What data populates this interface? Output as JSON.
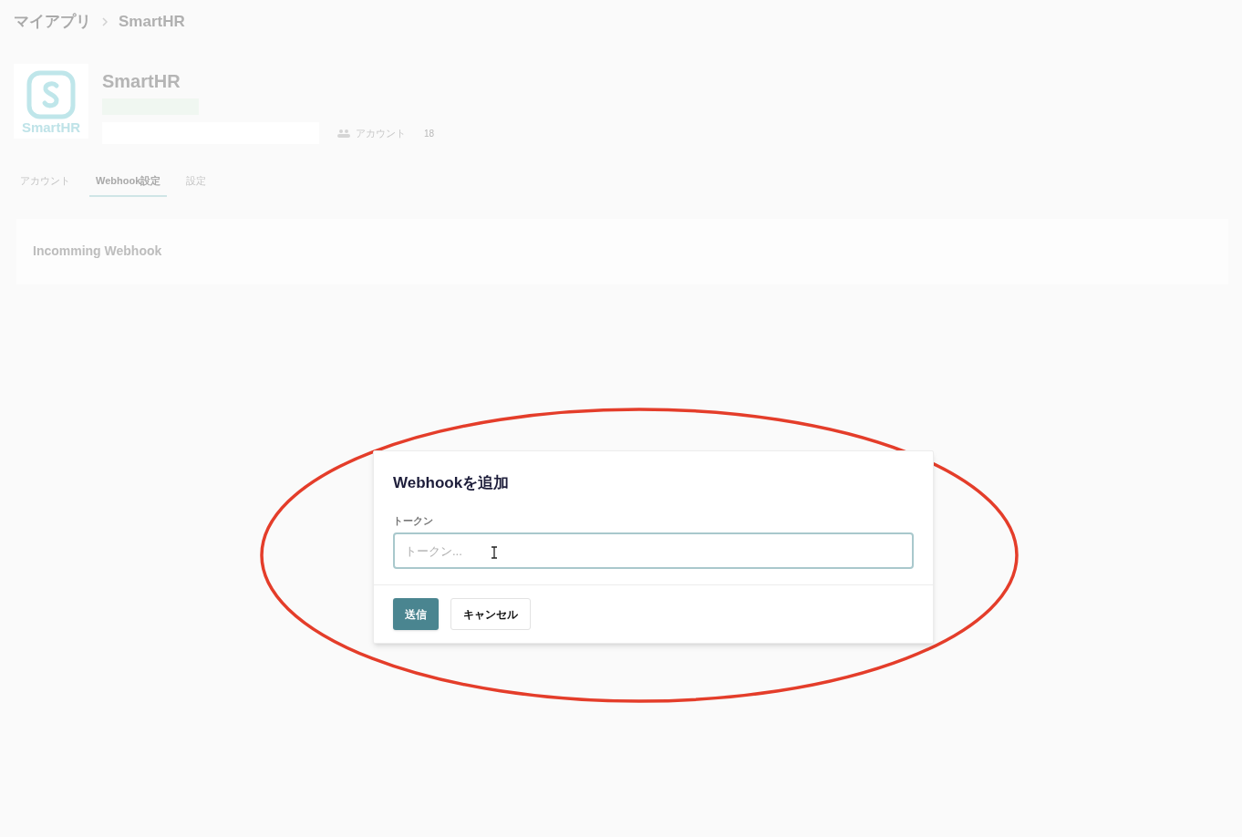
{
  "breadcrumb": [
    "マイアプリ",
    "SmartHR"
  ],
  "app": {
    "logo_text": "SmartHR",
    "name": "SmartHR",
    "accounts_label": "アカウント",
    "accounts_count": "18"
  },
  "tabs": [
    {
      "label": "アカウント",
      "selected": false
    },
    {
      "label": "Webhook設定",
      "selected": true
    },
    {
      "label": "設定",
      "selected": false
    }
  ],
  "section": {
    "title": "Incomming Webhook"
  },
  "dialog": {
    "title": "Webhookを追加",
    "field_label": "トークン",
    "placeholder": "トークン...",
    "buttons": [
      {
        "label": "送信",
        "kind": "primary"
      },
      {
        "label": "キャンセル",
        "kind": "secondary"
      }
    ]
  },
  "annotation": {
    "kind": "ellipse",
    "color": "#e43d2a"
  }
}
